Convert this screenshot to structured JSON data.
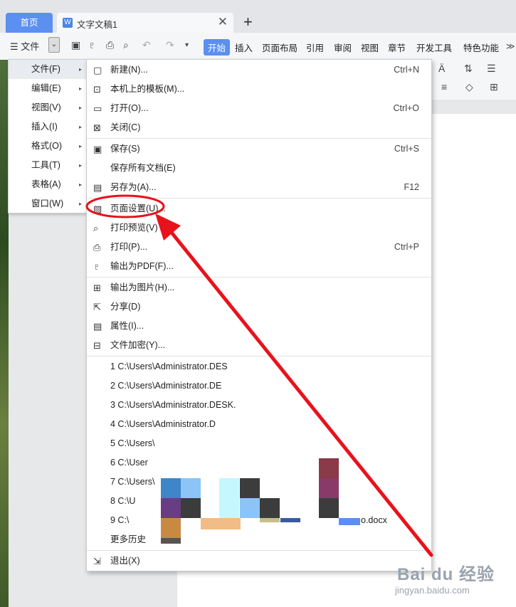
{
  "tabbar": {
    "home": "首页",
    "doc_title": "文字文稿1",
    "doc_icon": "W",
    "close": "✕",
    "add": "+"
  },
  "ribbon": {
    "menu_label": "文件",
    "tabs": [
      "开始",
      "插入",
      "页面布局",
      "引用",
      "审阅",
      "视图",
      "章节",
      "开发工具",
      "特色功能"
    ],
    "active_tab": "开始"
  },
  "main_menu": [
    {
      "label": "文件(F)"
    },
    {
      "label": "编辑(E)"
    },
    {
      "label": "视图(V)"
    },
    {
      "label": "插入(I)"
    },
    {
      "label": "格式(O)"
    },
    {
      "label": "工具(T)"
    },
    {
      "label": "表格(A)"
    },
    {
      "label": "窗口(W)"
    }
  ],
  "submenu": [
    {
      "icon": "new-icon",
      "label": "新建(N)...",
      "shortcut": "Ctrl+N"
    },
    {
      "icon": "template-icon",
      "label": "本机上的模板(M)...",
      "shortcut": ""
    },
    {
      "icon": "open-icon",
      "label": "打开(O)...",
      "shortcut": "Ctrl+O"
    },
    {
      "icon": "close-doc-icon",
      "label": "关闭(C)",
      "shortcut": ""
    },
    {
      "icon": "save-icon",
      "label": "保存(S)",
      "shortcut": "Ctrl+S"
    },
    {
      "icon": "",
      "label": "保存所有文档(E)",
      "shortcut": ""
    },
    {
      "icon": "save-as-icon",
      "label": "另存为(A)...",
      "shortcut": "F12"
    },
    {
      "icon": "page-setup-icon",
      "label": "页面设置(U)...",
      "shortcut": ""
    },
    {
      "icon": "print-preview-icon",
      "label": "打印预览(V)",
      "shortcut": ""
    },
    {
      "icon": "print-icon",
      "label": "打印(P)...",
      "shortcut": "Ctrl+P"
    },
    {
      "icon": "export-pdf-icon",
      "label": "输出为PDF(F)...",
      "shortcut": ""
    },
    {
      "icon": "export-image-icon",
      "label": "输出为图片(H)...",
      "shortcut": ""
    },
    {
      "icon": "share-icon",
      "label": "分享(D)",
      "shortcut": ""
    },
    {
      "icon": "properties-icon",
      "label": "属性(I)...",
      "shortcut": ""
    },
    {
      "icon": "encrypt-icon",
      "label": "文件加密(Y)...",
      "shortcut": ""
    }
  ],
  "recent": [
    "1 C:\\Users\\Administrator.DES",
    "2 C:\\Users\\Administrator.DE",
    "3 C:\\Users\\Administrator.DESK.",
    "4 C:\\Users\\Administrator.D",
    "5 C:\\Users\\",
    "6 C:\\User",
    "7 C:\\Users\\",
    "8 C:\\U",
    "9 C:\\",
    "更多历史"
  ],
  "recent_tail": "o.docx",
  "exit_label": "退出(X)",
  "watermark": {
    "brand": "Bai du 经验",
    "url": "jingyan.baidu.com"
  },
  "colors": {
    "accent": "#5b8ff0",
    "annotation": "#e8121c"
  }
}
